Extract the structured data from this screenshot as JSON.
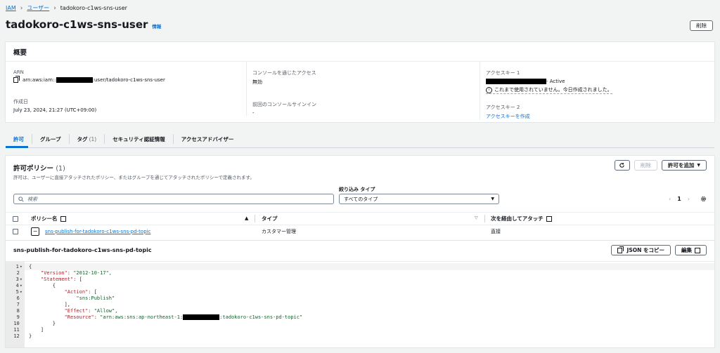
{
  "breadcrumb": {
    "root": "IAM",
    "users": "ユーザー",
    "current": "tadokoro-c1ws-sns-user"
  },
  "header": {
    "title": "tadokoro-c1ws-sns-user",
    "info": "情報",
    "delete": "削除"
  },
  "summary": {
    "title": "概要",
    "arn_label": "ARN",
    "arn_prefix": "arn:aws:iam::",
    "arn_suffix": ":user/tadokoro-c1ws-sns-user",
    "created_label": "作成日",
    "created_value": "July 23, 2024, 21:27 (UTC+09:00)",
    "console_label": "コンソールを通じたアクセス",
    "console_value": "無効",
    "last_signin_label": "前回のコンソールサインイン",
    "last_signin_value": "-",
    "key1_label": "アクセスキー 1",
    "key1_status": " - Active",
    "key1_note": "これまで使用されていません。今日作成されました。",
    "key2_label": "アクセスキー 2",
    "key2_link": "アクセスキーを作成"
  },
  "tabs": [
    {
      "label": "許可",
      "count": ""
    },
    {
      "label": "グループ",
      "count": ""
    },
    {
      "label": "タグ",
      "count": "(1)"
    },
    {
      "label": "セキュリティ認証情報",
      "count": ""
    },
    {
      "label": "アクセスアドバイザー",
      "count": ""
    }
  ],
  "permissions": {
    "title": "許可ポリシー",
    "count": "(1)",
    "description": "許可は、ユーザーに直接アタッチされたポリシー、またはグループを通じてアタッチされたポリシーで定義されます。",
    "delete": "削除",
    "add": "許可を追加",
    "filter_label": "絞り込み タイプ",
    "search_placeholder": "検索",
    "filter_value": "すべてのタイプ",
    "page": "1",
    "columns": {
      "name": "ポリシー名",
      "type": "タイプ",
      "attached_via": "次を経由してアタッチ"
    },
    "rows": [
      {
        "name": "sns-publish-for-tadokoro-c1ws-sns-pd-topic",
        "type": "カスタマー管理",
        "attached_via": "直接"
      }
    ]
  },
  "detail": {
    "title": "sns-publish-for-tadokoro-c1ws-sns-pd-topic",
    "copy_json": "JSON をコピー",
    "edit": "編集",
    "code": {
      "l1": "{",
      "l2a": "    \"Version\": ",
      "l2b": "\"2012-10-17\",",
      "l3a": "    \"Statement\": ",
      "l3b": "[",
      "l4": "        {",
      "l5a": "            \"Action\": ",
      "l5b": "[",
      "l6": "                \"sns:Publish\"",
      "l7": "            ],",
      "l8a": "            \"Effect\": ",
      "l8b": "\"Allow\",",
      "l9a": "            \"Resource\": ",
      "l9b": "\"arn:aws:sns:ap-northeast-1:",
      "l9c": ":tadokoro-c1ws-sns-pd-topic\"",
      "l10": "        }",
      "l11": "    ]",
      "l12": "}"
    }
  }
}
